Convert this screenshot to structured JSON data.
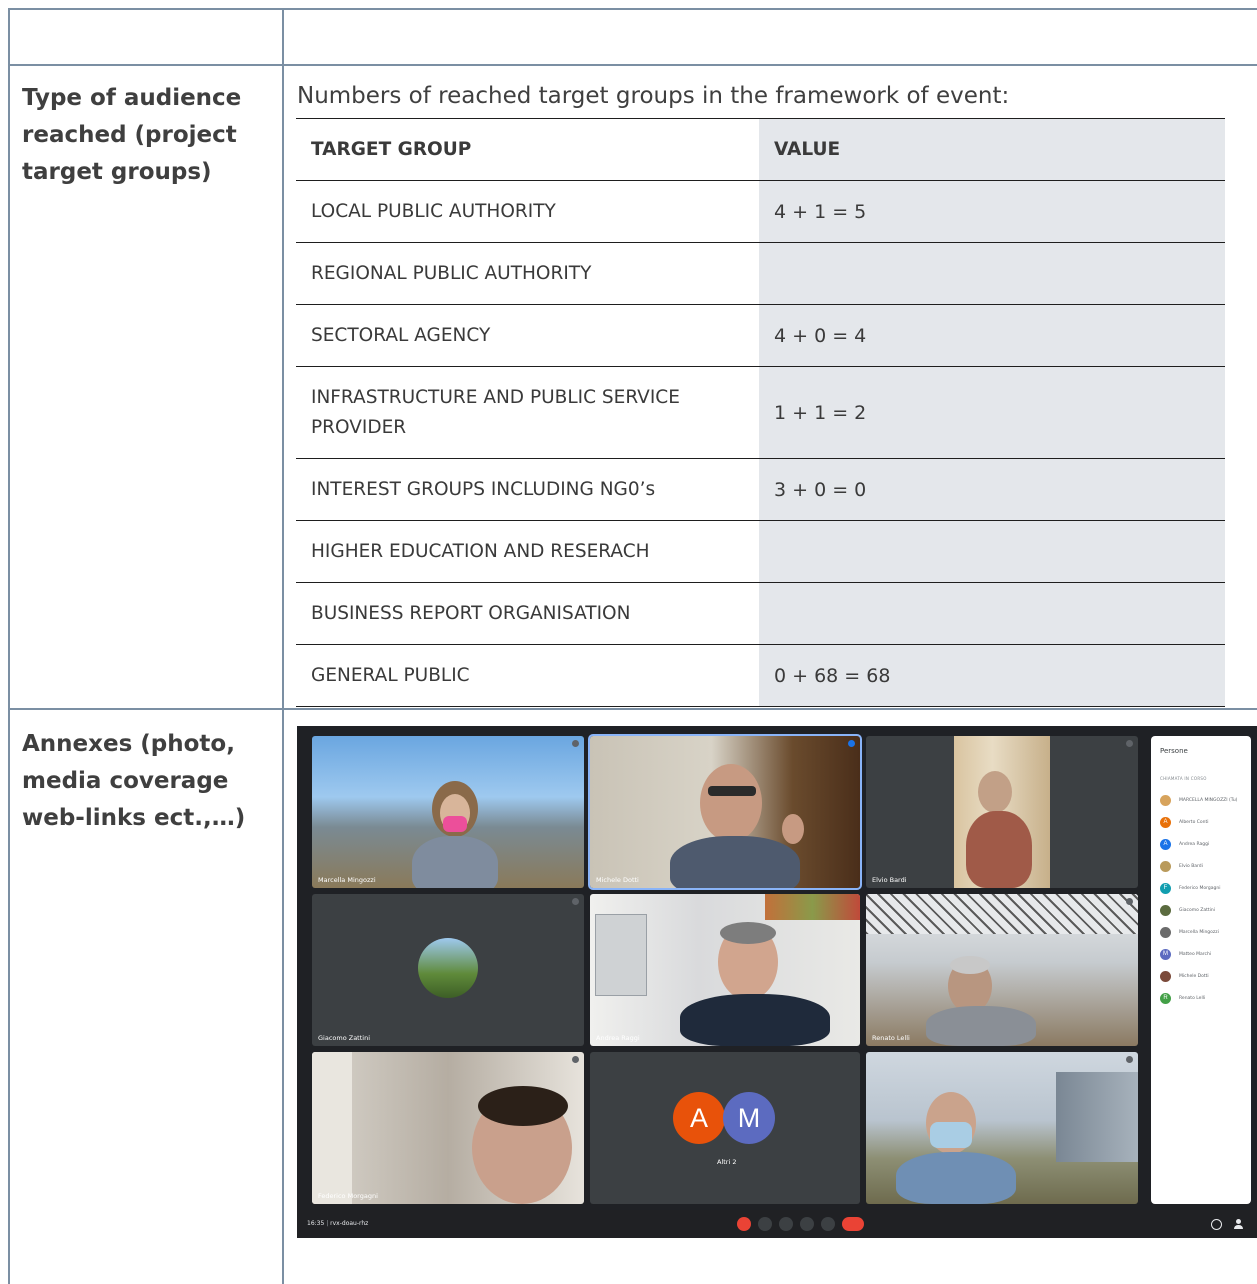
{
  "left_labels": {
    "audience": "Type of audience reached (project target groups)",
    "annexes": "Annexes (photo, media coverage web-links ect.,…)"
  },
  "intro_text": "Numbers of reached target groups in the framework of event:",
  "target_table": {
    "headers": [
      "TARGET GROUP",
      "VALUE"
    ],
    "rows": [
      {
        "group": "LOCAL PUBLIC AUTHORITY",
        "value": "4 + 1 = 5"
      },
      {
        "group": "REGIONAL PUBLIC AUTHORITY",
        "value": ""
      },
      {
        "group": "SECTORAL AGENCY",
        "value": "4 + 0 = 4"
      },
      {
        "group": "INFRASTRUCTURE AND PUBLIC SERVICE PROVIDER",
        "value": "1 + 1 = 2"
      },
      {
        "group": "INTEREST GROUPS INCLUDING NG0’s",
        "value": "3 + 0 = 0"
      },
      {
        "group": "HIGHER EDUCATION AND RESERACH",
        "value": ""
      },
      {
        "group": "BUSINESS REPORT ORGANISATION",
        "value": ""
      },
      {
        "group": "GENERAL PUBLIC",
        "value": "0 + 68 = 68"
      }
    ]
  },
  "meeting": {
    "tiles": [
      "Marcella Mingozzi",
      "Michele Dotti",
      "Elvio Bardi",
      "Giacomo Zattini",
      "Andrea Raggi",
      "Renato Lelli",
      "Federico Morgagni",
      "Altri 2",
      ""
    ],
    "other_initials": [
      "A",
      "M"
    ],
    "people_panel": {
      "title": "Persone",
      "subtitle": "CHIAMATA IN CORSO",
      "people": [
        {
          "name": "MARCELLA MINGOZZI (Tu)",
          "initial": "",
          "color": "#d7a35c"
        },
        {
          "name": "Alberto Conti",
          "initial": "A",
          "color": "#e8710a"
        },
        {
          "name": "Andrea Raggi",
          "initial": "A",
          "color": "#1a73e8"
        },
        {
          "name": "Elvio Bardi",
          "initial": "",
          "color": "#b99a5b"
        },
        {
          "name": "Federico Morgagni",
          "initial": "F",
          "color": "#129eaf"
        },
        {
          "name": "Giacomo Zattini",
          "initial": "",
          "color": "#5b6b3f"
        },
        {
          "name": "Marcella Mingozzi",
          "initial": "",
          "color": "#6b6b6b"
        },
        {
          "name": "Matteo Marchi",
          "initial": "M",
          "color": "#5c6bc0"
        },
        {
          "name": "Michele Dotti",
          "initial": "",
          "color": "#7b4a3a"
        },
        {
          "name": "Renato Lelli",
          "initial": "R",
          "color": "#43a047"
        }
      ]
    },
    "bottom_bar": {
      "time": "16:35",
      "meeting_code": "rvx-doau-rhz"
    }
  }
}
